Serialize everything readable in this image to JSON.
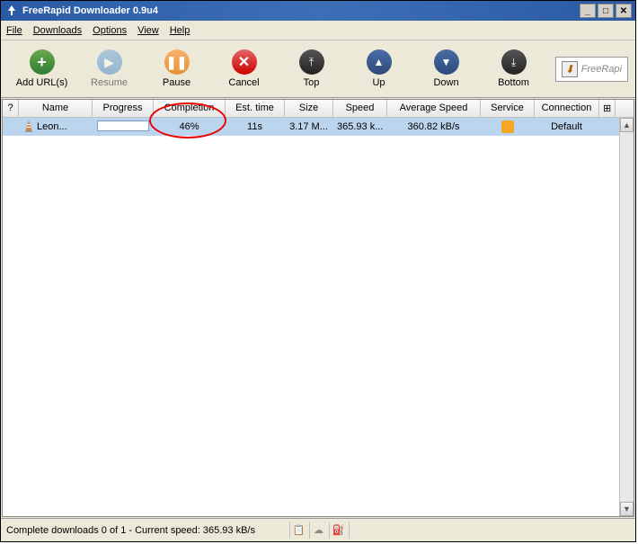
{
  "window": {
    "title": "FreeRapid Downloader 0.9u4"
  },
  "menu": [
    "File",
    "Downloads",
    "Options",
    "View",
    "Help"
  ],
  "toolbar": {
    "add": "Add URL(s)",
    "resume": "Resume",
    "pause": "Pause",
    "cancel": "Cancel",
    "top": "Top",
    "up": "Up",
    "down": "Down",
    "bottom": "Bottom"
  },
  "sidebox": {
    "text": "FreeRapi"
  },
  "columns": {
    "q": "?",
    "name": "Name",
    "progress": "Progress",
    "completion": "Completion",
    "est": "Est. time",
    "size": "Size",
    "speed": "Speed",
    "avg": "Average Speed",
    "service": "Service",
    "connection": "Connection"
  },
  "rows": [
    {
      "name": "Leon...",
      "progress_pct": 46,
      "completion": "46%",
      "est": "11s",
      "size": "3.17 M...",
      "speed": "365.93 k...",
      "avg": "360.82 kB/s",
      "connection": "Default"
    }
  ],
  "status": {
    "text": "Complete downloads 0 of 1 - Current speed: 365.93 kB/s"
  },
  "annotation": {
    "ellipse_target": "completion-column"
  }
}
